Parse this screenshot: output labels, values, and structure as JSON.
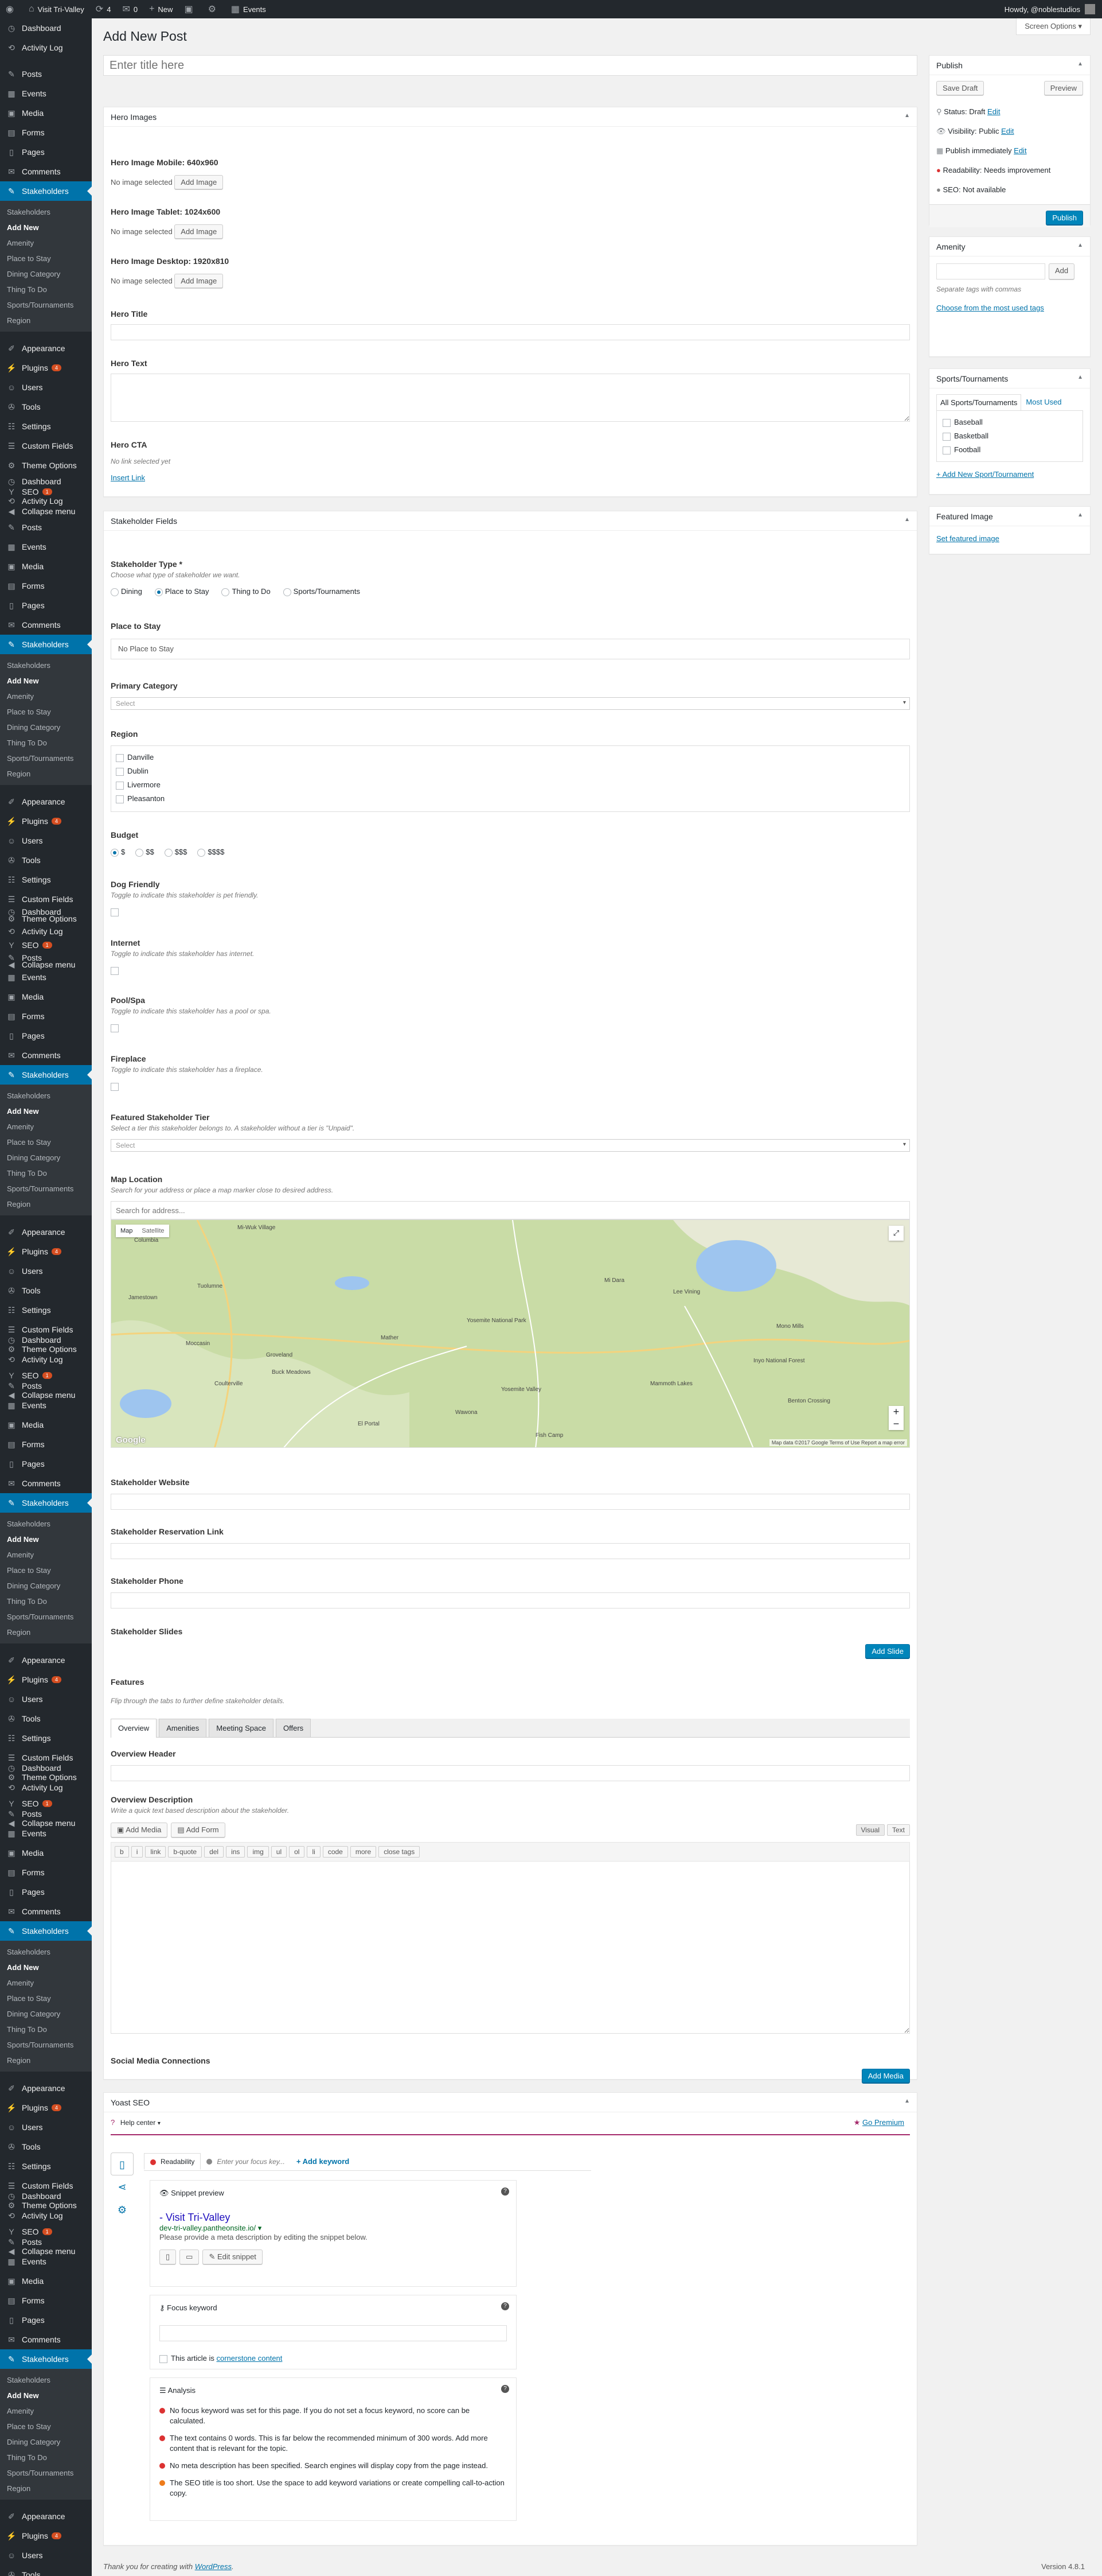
{
  "adminbar": {
    "site_name": "Visit Tri-Valley",
    "updates_count": "4",
    "comments_count": "0",
    "new_label": "New",
    "events_label": "Events",
    "howdy": "Howdy, @noblestudios"
  },
  "sidebar": {
    "blocks": [
      {
        "items": [
          {
            "label": "Dashboard",
            "icon": "dashboard-icon"
          },
          {
            "label": "Activity Log",
            "icon": "activity-icon"
          },
          {
            "label": "Posts",
            "icon": "pin-icon"
          },
          {
            "label": "Events",
            "icon": "calendar-icon"
          },
          {
            "label": "Media",
            "icon": "media-icon"
          },
          {
            "label": "Forms",
            "icon": "forms-icon"
          },
          {
            "label": "Pages",
            "icon": "pages-icon"
          },
          {
            "label": "Comments",
            "icon": "comments-icon"
          }
        ],
        "current": "Stakeholders"
      }
    ],
    "stakeholders_label": "Stakeholders",
    "submenu": [
      "Stakeholders",
      "Add New",
      "Amenity",
      "Place to Stay",
      "Dining Category",
      "Thing To Do",
      "Sports/Tournaments",
      "Region"
    ],
    "submenu_current": "Add New",
    "bottom_items": [
      {
        "label": "Appearance",
        "icon": "appearance-icon"
      },
      {
        "label": "Plugins",
        "icon": "plugins-icon",
        "badge": "4"
      },
      {
        "label": "Users",
        "icon": "users-icon"
      },
      {
        "label": "Tools",
        "icon": "tools-icon"
      },
      {
        "label": "Settings",
        "icon": "settings-icon"
      },
      {
        "label": "Custom Fields",
        "icon": "custom-fields-icon"
      },
      {
        "label": "Theme Options",
        "icon": "gear-icon"
      },
      {
        "label": "SEO",
        "icon": "seo-icon",
        "badge": "1"
      },
      {
        "label": "Collapse menu",
        "icon": "collapse-icon"
      }
    ]
  },
  "header": {
    "screen_options": "Screen Options",
    "page_title": "Add New Post",
    "title_placeholder": "Enter title here"
  },
  "hero": {
    "box_title": "Hero Images",
    "mobile_label": "Hero Image Mobile: 640x960",
    "tablet_label": "Hero Image Tablet: 1024x600",
    "desktop_label": "Hero Image Desktop: 1920x810",
    "no_image": "No image selected",
    "add_image": "Add Image",
    "title_label": "Hero Title",
    "text_label": "Hero Text",
    "cta_label": "Hero CTA",
    "no_link": "No link selected yet",
    "insert_link": "Insert Link"
  },
  "stakeholder": {
    "box_title": "Stakeholder Fields",
    "type_label": "Stakeholder Type *",
    "type_desc": "Choose what type of stakeholder we want.",
    "types": [
      "Dining",
      "Place to Stay",
      "Thing to Do",
      "Sports/Tournaments"
    ],
    "type_selected": "Place to Stay",
    "place_label": "Place to Stay",
    "place_value": "No Place to Stay",
    "primary_label": "Primary Category",
    "select_placeholder": "Select",
    "region_label": "Region",
    "regions": [
      "Danville",
      "Dublin",
      "Livermore",
      "Pleasanton"
    ],
    "budget_label": "Budget",
    "budgets": [
      "$",
      "$$",
      "$$$",
      "$$$$"
    ],
    "budget_selected": "$",
    "dog_label": "Dog Friendly",
    "dog_desc": "Toggle to indicate this stakeholder is pet friendly.",
    "internet_label": "Internet",
    "internet_desc": "Toggle to indicate this stakeholder has internet.",
    "pool_label": "Pool/Spa",
    "pool_desc": "Toggle to indicate this stakeholder has a pool or spa.",
    "fireplace_label": "Fireplace",
    "fireplace_desc": "Toggle to indicate this stakeholder has a fireplace.",
    "tier_label": "Featured Stakeholder Tier",
    "tier_desc": "Select a tier this stakeholder belongs to. A stakeholder without a tier is \"Unpaid\".",
    "map_label": "Map Location",
    "map_desc": "Search for your address or place a map marker close to desired address.",
    "map_search": "Search for address...",
    "map_tab_map": "Map",
    "map_tab_sat": "Satellite",
    "map_places": [
      "Columbia",
      "Tuolumne",
      "Jamestown",
      "Mather",
      "Mi-Wuk Village",
      "Mi Dara",
      "Lee Vining",
      "Yosemite National Park",
      "Mono Mills",
      "Inyo National Forest",
      "Yosemite Valley",
      "Buck Meadows",
      "Groveland",
      "Moccasin",
      "Coulterville",
      "El Portal",
      "Mammoth Lakes",
      "Benton Crossing",
      "Wawona",
      "Fish Camp"
    ],
    "map_google": "Google",
    "map_copyright": "Map data ©2017 Google  Terms of Use  Report a map error",
    "website_label": "Stakeholder Website",
    "reservation_label": "Stakeholder Reservation Link",
    "phone_label": "Stakeholder Phone",
    "slides_label": "Stakeholder Slides",
    "add_slide": "Add Slide",
    "features_label": "Features",
    "features_desc": "Flip through the tabs to further define stakeholder details.",
    "tabs": [
      "Overview",
      "Amenities",
      "Meeting Space",
      "Offers"
    ],
    "overview_header_label": "Overview Header",
    "overview_desc_label": "Overview Description",
    "overview_desc_desc": "Write a quick text based description about the stakeholder.",
    "add_media": "Add Media",
    "add_form": "Add Form",
    "visual_tab": "Visual",
    "text_tab": "Text",
    "quicktags": [
      "b",
      "i",
      "link",
      "b-quote",
      "del",
      "ins",
      "img",
      "ul",
      "ol",
      "li",
      "code",
      "more",
      "close tags"
    ],
    "social_label": "Social Media Connections",
    "add_media_btn": "Add Media"
  },
  "yoast": {
    "box_title": "Yoast SEO",
    "help_center": "Help center",
    "go_premium": "Go Premium",
    "tab_readability": "Readability",
    "tab_focus_placeholder": "Enter your focus key...",
    "add_keyword": "+ Add keyword",
    "snippet_title": "Snippet preview",
    "snippet_site": "- Visit Tri-Valley",
    "snippet_url": "dev-tri-valley.pantheonsite.io/",
    "snippet_desc": "Please provide a meta description by editing the snippet below.",
    "edit_snippet": "Edit snippet",
    "focus_title": "Focus keyword",
    "cornerstone_prefix": "This article is",
    "cornerstone_link": "cornerstone content",
    "analysis_title": "Analysis",
    "analysis_items": [
      {
        "text": "No focus keyword was set for this page. If you do not set a focus keyword, no score can be calculated.",
        "color": "#dc3232"
      },
      {
        "text": "The text contains 0 words. This is far below the recommended minimum of 300 words. Add more content that is relevant for the topic.",
        "color": "#dc3232"
      },
      {
        "text": "No meta description has been specified. Search engines will display copy from the page instead.",
        "color": "#dc3232"
      },
      {
        "text": "The SEO title is too short. Use the space to add keyword variations or create compelling call-to-action copy.",
        "color": "#ee7c1b"
      }
    ]
  },
  "publish": {
    "box_title": "Publish",
    "save_draft": "Save Draft",
    "preview": "Preview",
    "status": "Status: Draft",
    "visibility": "Visibility: Public",
    "publish_immediately": "Publish immediately",
    "edit": "Edit",
    "readability": "Readability: Needs improvement",
    "seo": "SEO: Not available",
    "publish_btn": "Publish"
  },
  "amenity": {
    "box_title": "Amenity",
    "add": "Add",
    "separate": "Separate tags with commas",
    "choose": "Choose from the most used tags"
  },
  "sports": {
    "box_title": "Sports/Tournaments",
    "tab_all": "All Sports/Tournaments",
    "tab_most": "Most Used",
    "items": [
      "Baseball",
      "Basketball",
      "Football"
    ],
    "add_new": "+ Add New Sport/Tournament"
  },
  "featured": {
    "box_title": "Featured Image",
    "set_link": "Set featured image"
  },
  "footer": {
    "thanks": "Thank you for creating with",
    "wp": "WordPress",
    "version": "Version 4.8.1"
  },
  "colors": {
    "accent": "#0073aa",
    "sidebar": "#23282d",
    "red": "#dc3232",
    "orange": "#ee7c1b"
  }
}
